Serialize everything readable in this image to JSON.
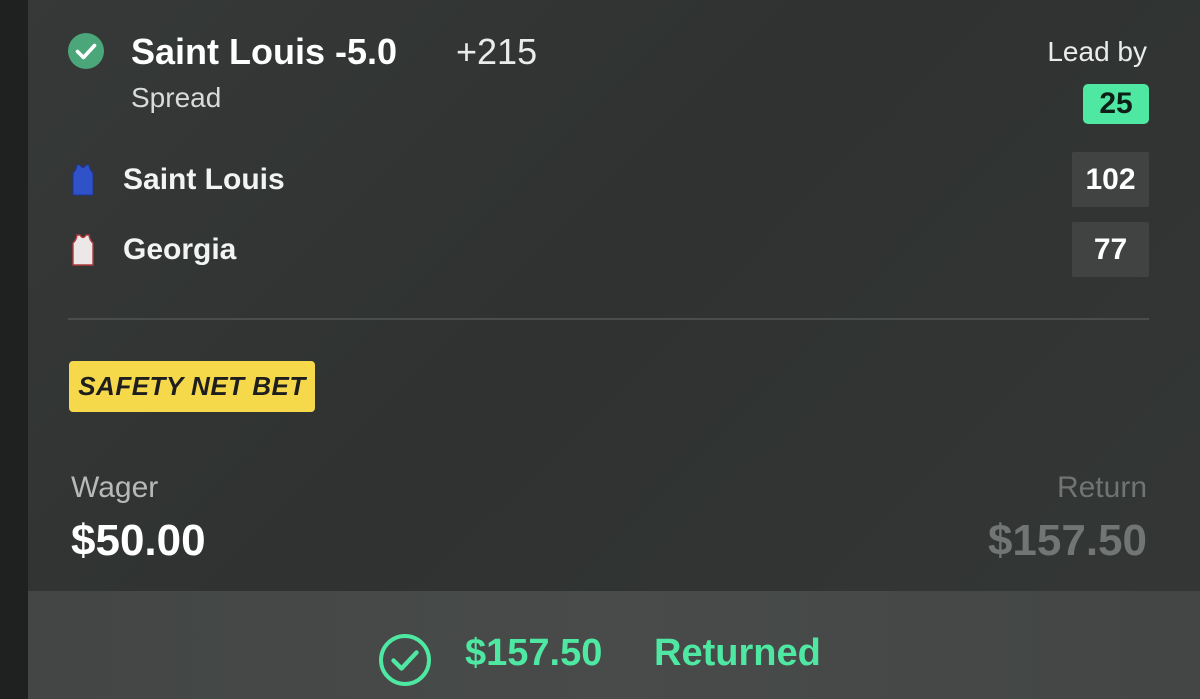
{
  "bet": {
    "status_icon": "check-circle-icon",
    "title": "Saint Louis -5.0",
    "odds": "+215",
    "type": "Spread"
  },
  "lead": {
    "label": "Lead by",
    "value": "25"
  },
  "teams": [
    {
      "name": "Saint Louis",
      "score": "102",
      "jersey_icon": "jersey-icon",
      "jersey_color": "#2f52c8"
    },
    {
      "name": "Georgia",
      "score": "77",
      "jersey_icon": "jersey-icon",
      "jersey_color": "#ece8e8"
    }
  ],
  "promo": {
    "label": "SAFETY NET BET"
  },
  "wager": {
    "label": "Wager",
    "value": "$50.00"
  },
  "return": {
    "label": "Return",
    "value": "$157.50"
  },
  "result": {
    "icon": "check-circle-outline-icon",
    "amount": "$157.50",
    "label": "Returned"
  },
  "colors": {
    "accent_green": "#4ee8a3",
    "promo_yellow": "#f6d94a",
    "card_bg": "#333635",
    "score_box_bg": "#404342"
  }
}
